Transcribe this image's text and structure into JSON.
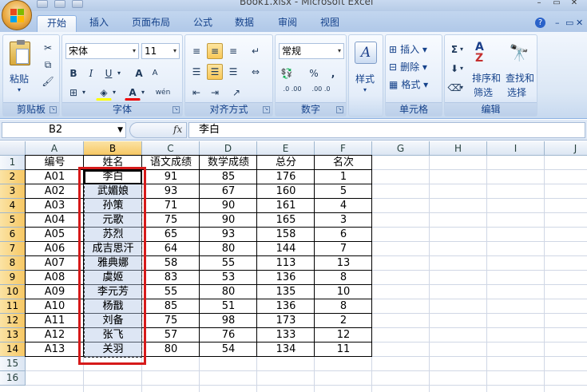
{
  "window": {
    "title": "Book1.xlsx - Microsoft Excel",
    "minimize": "–",
    "restore": "▭",
    "close": "✕"
  },
  "tabs": [
    {
      "label": "开始",
      "active": true
    },
    {
      "label": "插入",
      "active": false
    },
    {
      "label": "页面布局",
      "active": false
    },
    {
      "label": "公式",
      "active": false
    },
    {
      "label": "数据",
      "active": false
    },
    {
      "label": "审阅",
      "active": false
    },
    {
      "label": "视图",
      "active": false
    }
  ],
  "help_icon": "?",
  "ribbon": {
    "clipboard": {
      "label": "剪贴板",
      "paste": "粘贴"
    },
    "font": {
      "label": "字体",
      "name": "宋体",
      "size": "11",
      "bold": "B",
      "italic": "I",
      "underline": "U",
      "grow": "A",
      "shrink": "A",
      "wen": "wén"
    },
    "alignment": {
      "label": "对齐方式"
    },
    "number": {
      "label": "数字",
      "format": "常规",
      "percent": "%",
      "comma": ",",
      "inc_dec": ".0 .00",
      "dec_dec": ".00 .0"
    },
    "styles": {
      "label": "样式"
    },
    "cells": {
      "label": "单元格",
      "insert": "插入",
      "delete": "删除",
      "format": "格式"
    },
    "editing": {
      "label": "编辑",
      "sum": "Σ",
      "sort_filter": "排序和",
      "sort_filter_2": "筛选",
      "find_select": "查找和",
      "find_select_2": "选择"
    }
  },
  "formula_bar": {
    "name_box": "B2",
    "fx": "fx",
    "content": "李白"
  },
  "columns": [
    "A",
    "B",
    "C",
    "D",
    "E",
    "F",
    "G",
    "H",
    "I",
    "J"
  ],
  "rows": [
    "1",
    "2",
    "3",
    "4",
    "5",
    "6",
    "7",
    "8",
    "9",
    "10",
    "11",
    "12",
    "13",
    "14",
    "15",
    "16"
  ],
  "table": {
    "headers": [
      "编号",
      "姓名",
      "语文成绩",
      "数学成绩",
      "总分",
      "名次"
    ],
    "data": [
      [
        "A01",
        "李白",
        "91",
        "85",
        "176",
        "1"
      ],
      [
        "A02",
        "武媚娘",
        "93",
        "67",
        "160",
        "5"
      ],
      [
        "A03",
        "孙策",
        "71",
        "90",
        "161",
        "4"
      ],
      [
        "A04",
        "元歌",
        "75",
        "90",
        "165",
        "3"
      ],
      [
        "A05",
        "苏烈",
        "65",
        "93",
        "158",
        "6"
      ],
      [
        "A06",
        "成吉思汗",
        "64",
        "80",
        "144",
        "7"
      ],
      [
        "A07",
        "雅典娜",
        "58",
        "55",
        "113",
        "13"
      ],
      [
        "A08",
        "虞姬",
        "83",
        "53",
        "136",
        "8"
      ],
      [
        "A09",
        "李元芳",
        "55",
        "80",
        "135",
        "10"
      ],
      [
        "A10",
        "杨戬",
        "85",
        "51",
        "136",
        "8"
      ],
      [
        "A11",
        "刘备",
        "75",
        "98",
        "173",
        "2"
      ],
      [
        "A12",
        "张飞",
        "57",
        "76",
        "133",
        "12"
      ],
      [
        "A13",
        "关羽",
        "80",
        "54",
        "134",
        "11"
      ]
    ]
  },
  "colors": {
    "highlight_box": "#d61a1a",
    "selected_header": "#f7c865"
  }
}
